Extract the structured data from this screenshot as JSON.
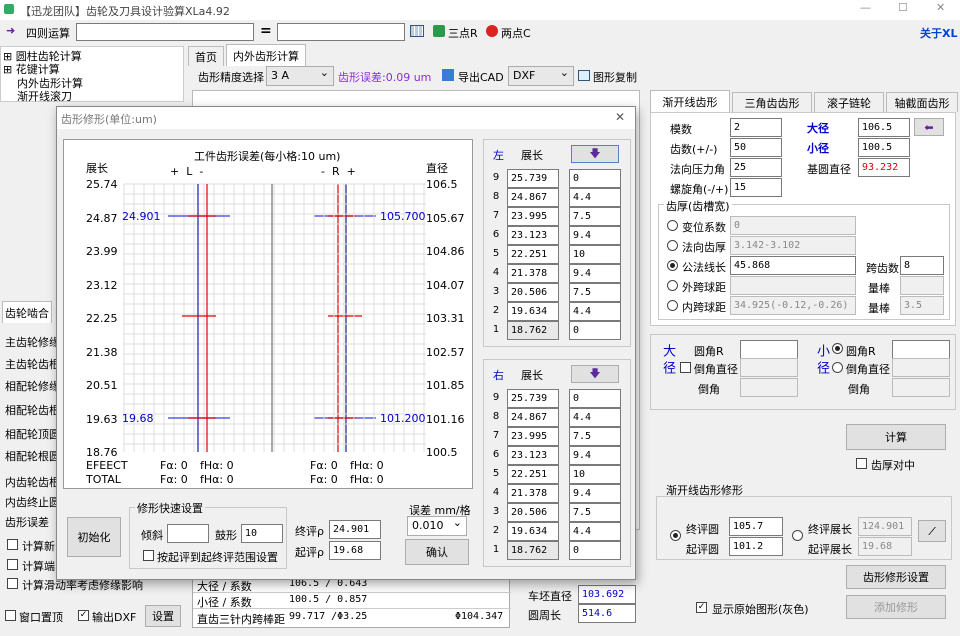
{
  "window": {
    "title": "【迅龙团队】齿轮及刀具设计验算XLa4.92",
    "about": "关于XL"
  },
  "toolbar": {
    "calc_label": "四则运算",
    "equals": "=",
    "three_point": "三点R",
    "two_point": "两点C"
  },
  "tree": {
    "items": [
      "圆柱齿轮计算",
      "花键计算",
      "内外齿形计算",
      "渐开线滚刀"
    ]
  },
  "main_tabs": [
    "首页",
    "内外齿形计算"
  ],
  "profile_bar": {
    "precision_label": "齿形精度选择",
    "precision_value": "3  A",
    "error_text": "齿形误差:0.09 um",
    "export_cad": "导出CAD",
    "format_value": "DXF",
    "copy_label": "图形复制"
  },
  "left_panel": {
    "tab": "齿轮啮合",
    "rows": [
      "主齿轮修缘",
      "主齿轮齿根",
      "相配轮修缘",
      "相配轮齿根",
      "相配轮顶圆",
      "相配轮根圆"
    ],
    "rows2": [
      "内齿轮齿根",
      "内齿终止圆",
      "齿形误差"
    ],
    "checks": [
      "计算新",
      "计算端",
      "计算滑动率考虑修缘影响"
    ],
    "window_top": "窗口置顶",
    "output_dxf": "输出DXF",
    "settings": "设置"
  },
  "right_tabs": [
    "渐开线齿形",
    "三角齿齿形",
    "滚子链轮",
    "轴截面齿形"
  ],
  "gear_params": {
    "modulus_label": "模数",
    "modulus": "2",
    "teeth_label": "齿数(+/-)",
    "teeth": "50",
    "pressure_label": "法向压力角",
    "pressure": "25",
    "helix_label": "螺旋角(-/+)",
    "helix": "15",
    "major_label": "大径",
    "major": "106.5",
    "minor_label": "小径",
    "minor": "100.5",
    "base_label": "基圆直径",
    "base": "93.232",
    "thickness_group": "齿厚(齿槽宽)",
    "options": [
      {
        "label": "变位系数",
        "value": "0"
      },
      {
        "label": "法向齿厚",
        "value": "3.142-3.102"
      },
      {
        "label": "公法线长",
        "value": "45.868"
      },
      {
        "label": "外跨球距",
        "value": ""
      },
      {
        "label": "内跨球距",
        "value": "34.925(-0.12,-0.26)"
      }
    ],
    "span_label": "跨齿数",
    "span": "8",
    "ball_label": "量棒",
    "ball2": "3.5"
  },
  "round_group": {
    "big": "大径",
    "small": "小径",
    "corner_r": "圆角R",
    "chamfer_d": "倒角直径",
    "chamfer": "倒角"
  },
  "compute": {
    "button": "计算",
    "thickness_center": "齿厚对中"
  },
  "modify_group": {
    "title": "渐开线齿形修形",
    "eval_circle": "终评圆",
    "eval_circle_v": "105.7",
    "start_circle": "起评圆",
    "start_circle_v": "101.2",
    "eval_length": "终评展长",
    "eval_length_v": "124.901",
    "start_length": "起评展长",
    "start_length_v": "19.68",
    "setup_button": "齿形修形设置",
    "show_original": "显示原始图形(灰色)",
    "add_button": "添加修形"
  },
  "bottom_table": {
    "rows": [
      {
        "label": "大径 / 系数",
        "value": "106.5 / 0.643"
      },
      {
        "label": "小径 / 系数",
        "value": "100.5 / 0.857"
      },
      {
        "label": "直齿三针内跨棒距",
        "value": "99.717 /Φ3.25",
        "extra": "Φ104.347"
      }
    ],
    "blank_dia_label": "车坯直径",
    "blank_dia": "103.692",
    "circ_label": "圆周长",
    "circ": "514.6"
  },
  "dialog": {
    "title": "齿形修形(单位:um)",
    "chart_title": "工件齿形误差(每小格:10 um)",
    "axis_left": "展长",
    "axis_right": "直径",
    "left_mark": "+  L  -",
    "right_mark": "-  R  +",
    "length_ticks": [
      "25.74",
      "24.87",
      "23.99",
      "23.12",
      "22.25",
      "21.38",
      "20.51",
      "19.63",
      "18.76"
    ],
    "diameter_ticks": [
      "106.5",
      "105.67",
      "104.86",
      "104.07",
      "103.31",
      "102.57",
      "101.85",
      "101.16",
      "100.5"
    ],
    "label_top_left": "24.901",
    "label_top_right": "105.700",
    "label_bot_left": "19.68",
    "label_bot_right": "101.200",
    "effect_label": "EFEECT",
    "total_label": "TOTAL",
    "f_alpha": "Fα: 0",
    "fh_alpha": "fHα: 0",
    "quick_group": "修形快速设置",
    "slope_label": "倾斜",
    "drum_label": "鼓形",
    "drum_value": "10",
    "by_range": "按起评到起终评范围设置",
    "init_button": "初始化",
    "end_eval_label": "终评ρ",
    "end_eval": "24.901",
    "start_eval_label": "起评ρ",
    "start_eval": "19.68",
    "error_label": "误差 mm/格",
    "error_value": "0.010",
    "confirm_button": "确认",
    "left_table": {
      "side": "左",
      "header": "展长",
      "rows": [
        {
          "n": "9",
          "len": "25.739",
          "v": "0"
        },
        {
          "n": "8",
          "len": "24.867",
          "v": "4.4"
        },
        {
          "n": "7",
          "len": "23.995",
          "v": "7.5"
        },
        {
          "n": "6",
          "len": "23.123",
          "v": "9.4"
        },
        {
          "n": "5",
          "len": "22.251",
          "v": "10"
        },
        {
          "n": "4",
          "len": "21.378",
          "v": "9.4"
        },
        {
          "n": "3",
          "len": "20.506",
          "v": "7.5"
        },
        {
          "n": "2",
          "len": "19.634",
          "v": "4.4"
        },
        {
          "n": "1",
          "len": "18.762",
          "v": "0"
        }
      ]
    },
    "right_table": {
      "side": "右",
      "header": "展长",
      "rows": [
        {
          "n": "9",
          "len": "25.739",
          "v": "0"
        },
        {
          "n": "8",
          "len": "24.867",
          "v": "4.4"
        },
        {
          "n": "7",
          "len": "23.995",
          "v": "7.5"
        },
        {
          "n": "6",
          "len": "23.123",
          "v": "9.4"
        },
        {
          "n": "5",
          "len": "22.251",
          "v": "10"
        },
        {
          "n": "4",
          "len": "21.378",
          "v": "9.4"
        },
        {
          "n": "3",
          "len": "20.506",
          "v": "7.5"
        },
        {
          "n": "2",
          "len": "19.634",
          "v": "4.4"
        },
        {
          "n": "1",
          "len": "18.762",
          "v": "0"
        }
      ]
    }
  },
  "colors": {
    "accent_blue": "#0000cc",
    "red": "#e00000",
    "title_bar": "#ffffff"
  }
}
